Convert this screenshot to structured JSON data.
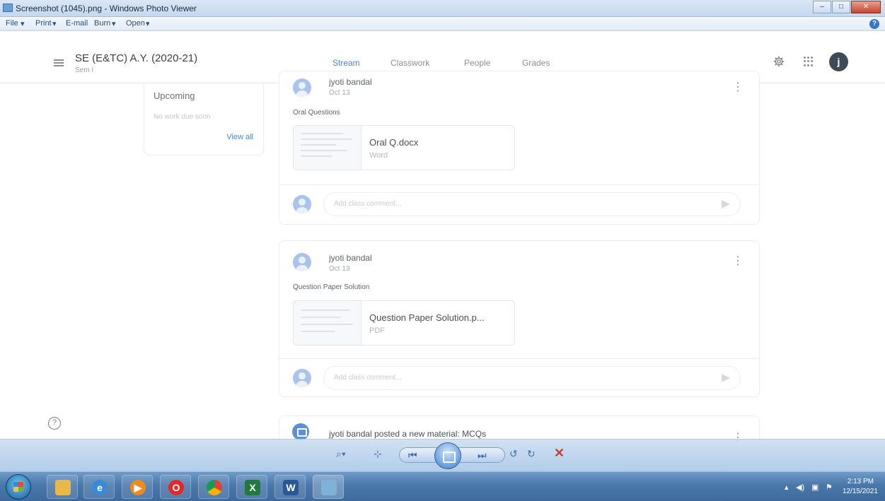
{
  "window": {
    "title": "Screenshot (1045).png - Windows Photo Viewer",
    "menu": [
      "File",
      "Print",
      "E-mail",
      "Burn",
      "Open"
    ],
    "help": "?"
  },
  "classroom": {
    "class_name": "SE (E&TC) A.Y. (2020-21)",
    "section": "Sem I",
    "tabs": [
      "Stream",
      "Classwork",
      "People",
      "Grades"
    ],
    "active_tab": "Stream",
    "avatar_letter": "j"
  },
  "upcoming": {
    "heading": "Upcoming",
    "empty_text": "No work due soon",
    "view_all": "View all"
  },
  "posts": [
    {
      "author": "jyoti bandal",
      "date": "Oct 13",
      "text": "Oral Questions",
      "attachment": {
        "name": "Oral Q.docx",
        "type": "Word"
      },
      "comment_placeholder": "Add class comment..."
    },
    {
      "author": "jyoti bandal",
      "date": "Oct 13",
      "text": "Question Paper Solution",
      "attachment": {
        "name": "Question Paper Solution.p...",
        "type": "PDF"
      },
      "comment_placeholder": "Add class comment..."
    },
    {
      "author": "jyoti bandal posted a new material: MCQs"
    }
  ],
  "viewer_controls": [
    "zoom",
    "actual-size",
    "previous",
    "slideshow",
    "next",
    "rotate-ccw",
    "rotate-cw",
    "delete"
  ],
  "taskbar": {
    "apps": [
      "explorer",
      "internet-explorer",
      "media",
      "opera",
      "chrome",
      "excel",
      "word",
      "photo-viewer"
    ],
    "time": "2:13 PM",
    "date": "12/15/2021"
  }
}
